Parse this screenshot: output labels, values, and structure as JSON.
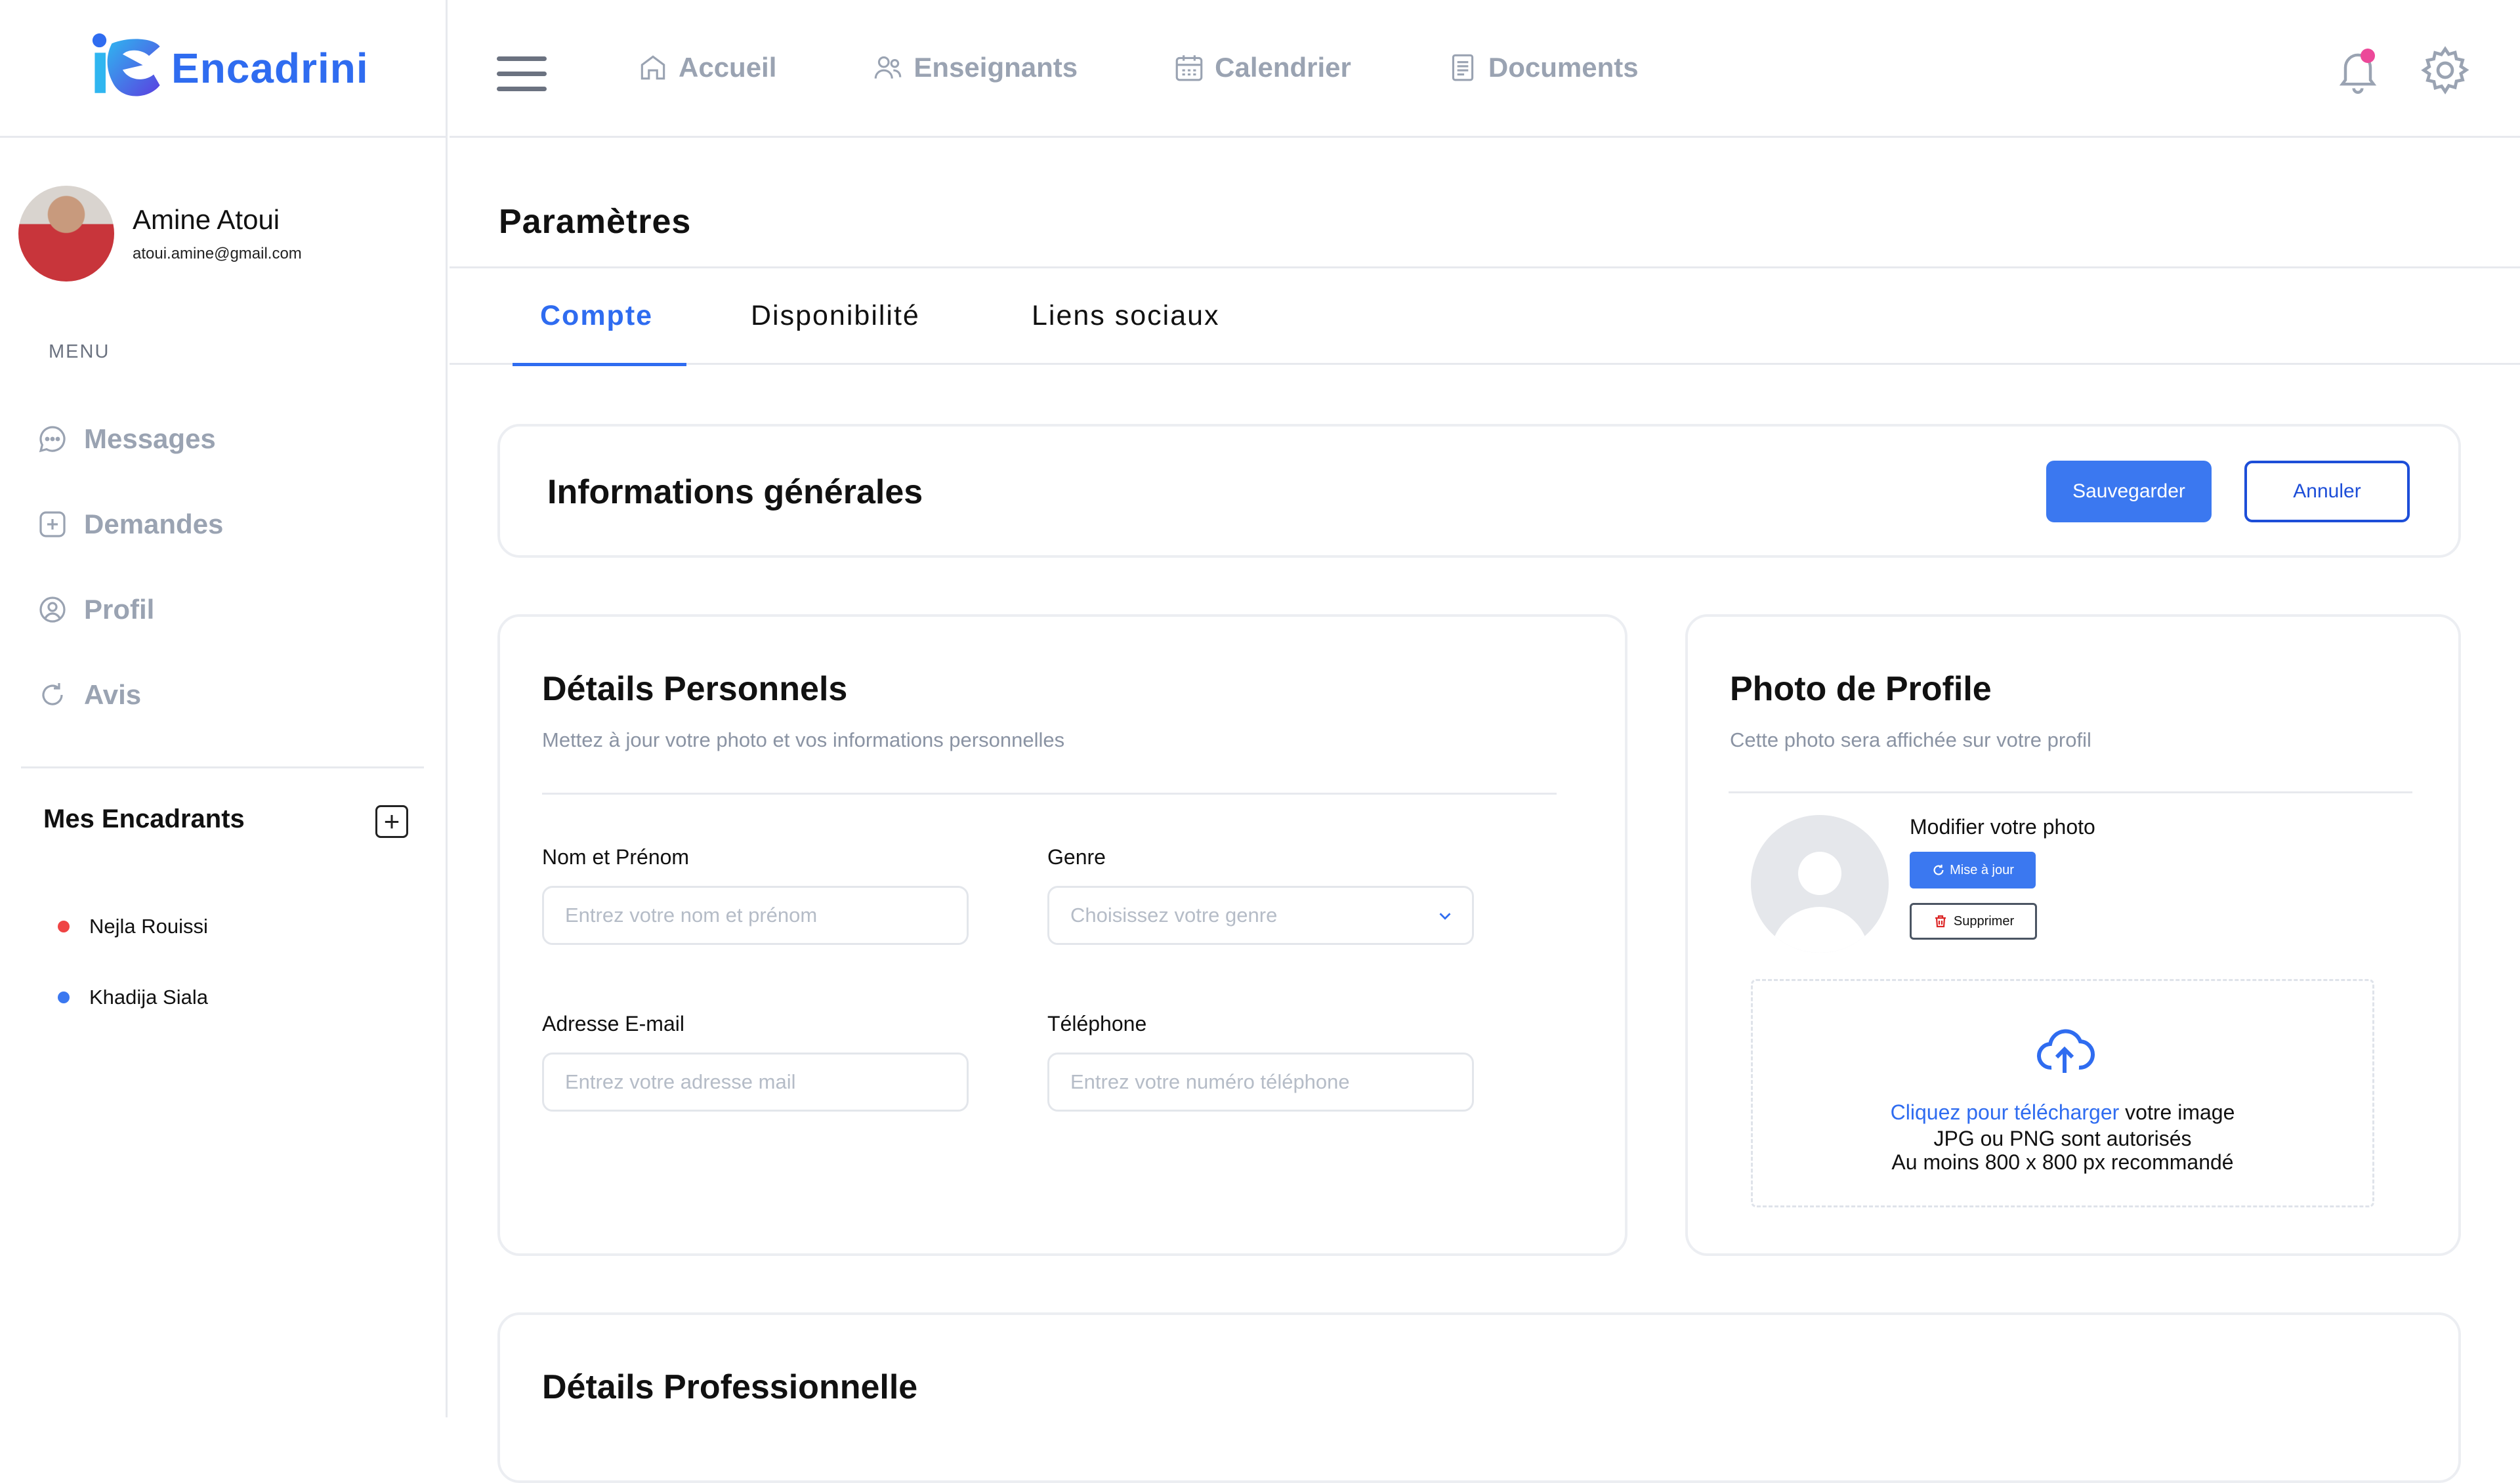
{
  "brand": {
    "name": "Encadrini"
  },
  "user": {
    "name": "Amine Atoui",
    "email": "atoui.amine@gmail.com"
  },
  "sidebar": {
    "menu_title": "MENU",
    "items": [
      {
        "label": "Messages",
        "icon": "chat-icon"
      },
      {
        "label": "Demandes",
        "icon": "plus-square-icon"
      },
      {
        "label": "Profil",
        "icon": "user-circle-icon"
      },
      {
        "label": "Avis",
        "icon": "refresh-icon"
      }
    ],
    "encadrants_title": "Mes Encadrants",
    "encadrants": [
      {
        "name": "Nejla Rouissi",
        "color": "#ef4444"
      },
      {
        "name": "Khadija Siala",
        "color": "#3b78f0"
      }
    ]
  },
  "nav": {
    "items": [
      {
        "label": "Accueil",
        "icon": "home-icon"
      },
      {
        "label": "Enseignants",
        "icon": "users-icon"
      },
      {
        "label": "Calendrier",
        "icon": "calendar-icon"
      },
      {
        "label": "Documents",
        "icon": "document-icon"
      }
    ]
  },
  "page": {
    "title": "Paramètres",
    "tabs": [
      "Compte",
      "Disponibilité",
      "Liens sociaux"
    ],
    "active_tab": "Compte"
  },
  "info": {
    "title": "Informations générales",
    "save_label": "Sauvegarder",
    "cancel_label": "Annuler"
  },
  "personal": {
    "title": "Détails Personnels",
    "subtitle": "Mettez à jour votre photo et vos informations personnelles",
    "name_label": "Nom et Prénom",
    "name_placeholder": "Entrez votre nom et prénom",
    "gender_label": "Genre",
    "gender_placeholder": "Choisissez votre genre",
    "email_label": "Adresse E-mail",
    "email_placeholder": "Entrez votre adresse mail",
    "phone_label": "Téléphone",
    "phone_placeholder": "Entrez votre numéro téléphone"
  },
  "photo": {
    "title": "Photo de Profile",
    "subtitle": "Cette photo sera affichée sur votre profil",
    "modify_label": "Modifier votre photo",
    "update_label": "Mise à jour",
    "delete_label": "Supprimer",
    "upload_link": "Cliquez pour télécharger",
    "upload_suffix": " votre image",
    "formats": "JPG ou PNG sont autorisés",
    "size_hint": "Au moins 800 x 800 px recommandé"
  },
  "professional": {
    "title": "Détails Professionnelle"
  },
  "colors": {
    "accent": "#2f6cf0",
    "muted": "#9aa3b2",
    "notification": "#ec4899"
  }
}
